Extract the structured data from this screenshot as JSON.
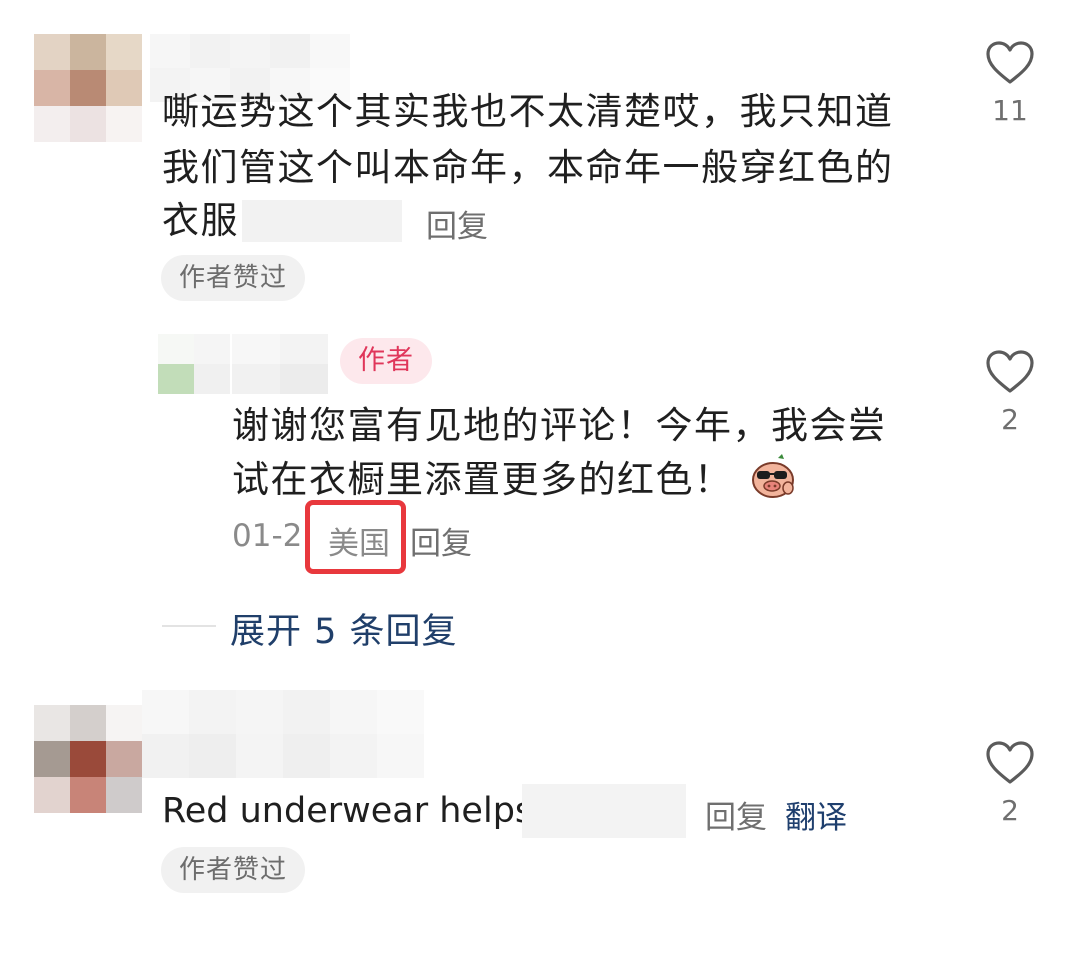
{
  "comments": [
    {
      "lines": [
        "嘶运势这个其实我也不太清楚哎，我只知道",
        "我们管这个叫本命年，本命年一般穿红色的",
        "衣服"
      ],
      "reply_label": "回复",
      "badge": "作者赞过",
      "like_count": "11",
      "replies": [
        {
          "author_tag": "作者",
          "lines": [
            "谢谢您富有见地的评论！今年，我会尝",
            "试在衣橱里添置更多的红色！"
          ],
          "date": "01-2",
          "location": "美国",
          "reply_label": "回复",
          "like_count": "2"
        }
      ],
      "expand_label": "展开 5 条回复"
    },
    {
      "lines": [
        "Red underwear helps"
      ],
      "reply_label": "回复",
      "translate_label": "翻译",
      "badge": "作者赞过",
      "like_count": "2"
    }
  ],
  "icons": {
    "like": "heart-outline-icon",
    "sticker": "pig-sunglasses-emoji-icon"
  },
  "colors": {
    "author_tag_bg": "#fde8ec",
    "author_tag_text": "#e0365a",
    "highlight": "#e8383d",
    "link": "#203f6a"
  }
}
